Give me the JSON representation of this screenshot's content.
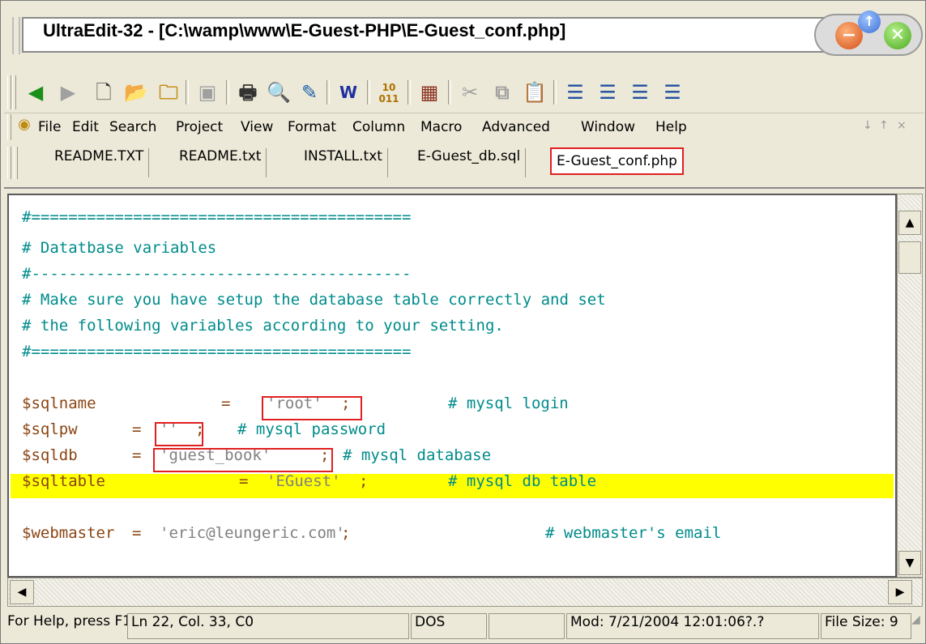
{
  "window": {
    "title": "UltraEdit-32 - [C:\\wamp\\www\\E-Guest-PHP\\E-Guest_conf.php]",
    "minimize_icon": "minimize-icon",
    "restore_icon": "restore-icon",
    "close_icon": "close-icon"
  },
  "toolbar": {
    "icons": [
      "back-arrow-icon",
      "forward-arrow-icon",
      "new-file-icon",
      "open-folder-icon",
      "open-recent-icon",
      "save-icon",
      "print-icon",
      "print-preview-icon",
      "spell-check-icon",
      "word-wrap-icon",
      "hex-mode-icon",
      "column-mode-icon",
      "cut-icon",
      "copy-icon",
      "paste-icon",
      "align-left-icon",
      "align-center-icon",
      "align-right-icon",
      "justify-icon"
    ]
  },
  "menu": {
    "items": [
      "File",
      "Edit",
      "Search",
      "Project",
      "View",
      "Format",
      "Column",
      "Macro",
      "Advanced",
      "Window",
      "Help"
    ]
  },
  "tabs": [
    {
      "label": "README.TXT"
    },
    {
      "label": "README.txt"
    },
    {
      "label": "INSTALL.txt"
    },
    {
      "label": "E-Guest_db.sql"
    },
    {
      "label": "E-Guest_conf.php",
      "active": true
    }
  ],
  "editor": {
    "lines": [
      {
        "comment": "#========================================="
      },
      {
        "comment": "# Datatbase variables"
      },
      {
        "comment": "#-----------------------------------------"
      },
      {
        "comment": "# Make sure you have setup the database table correctly and set"
      },
      {
        "comment": "# the following variables according to your setting."
      },
      {
        "comment": "#========================================="
      },
      {
        "comment": ""
      },
      {
        "var": "$sqlname",
        "op": "=",
        "str": "'root'",
        "semi": ";",
        "comment": "# mysql login"
      },
      {
        "var": "$sqlpw",
        "op": "=",
        "str": "''",
        "semi": ";",
        "comment": "# mysql password"
      },
      {
        "var": "$sqldb",
        "op": "=",
        "str": "'guest_book'",
        "semi": ";",
        "comment": "# mysql database"
      },
      {
        "var": "$sqltable",
        "op": "=",
        "str": "'EGuest'",
        "semi": ";",
        "comment": "# mysql db table"
      },
      {
        "comment": ""
      },
      {
        "var": "$webmaster",
        "op": "=",
        "str": "'eric@leungeric.com'",
        "semi": ";",
        "comment": "# webmaster's email"
      }
    ]
  },
  "status": {
    "help": "For Help, press F1",
    "position": "Ln 22, Col. 33, C0",
    "format": "DOS",
    "blank": "",
    "modified": "Mod: 7/21/2004 12:01:06?.?",
    "filesize": "File Size: 9"
  },
  "colors": {
    "comment": "#008b8b",
    "variable": "#8b4513",
    "string": "#808080",
    "highlight": "#ffff00",
    "annotation": "#e02020"
  }
}
